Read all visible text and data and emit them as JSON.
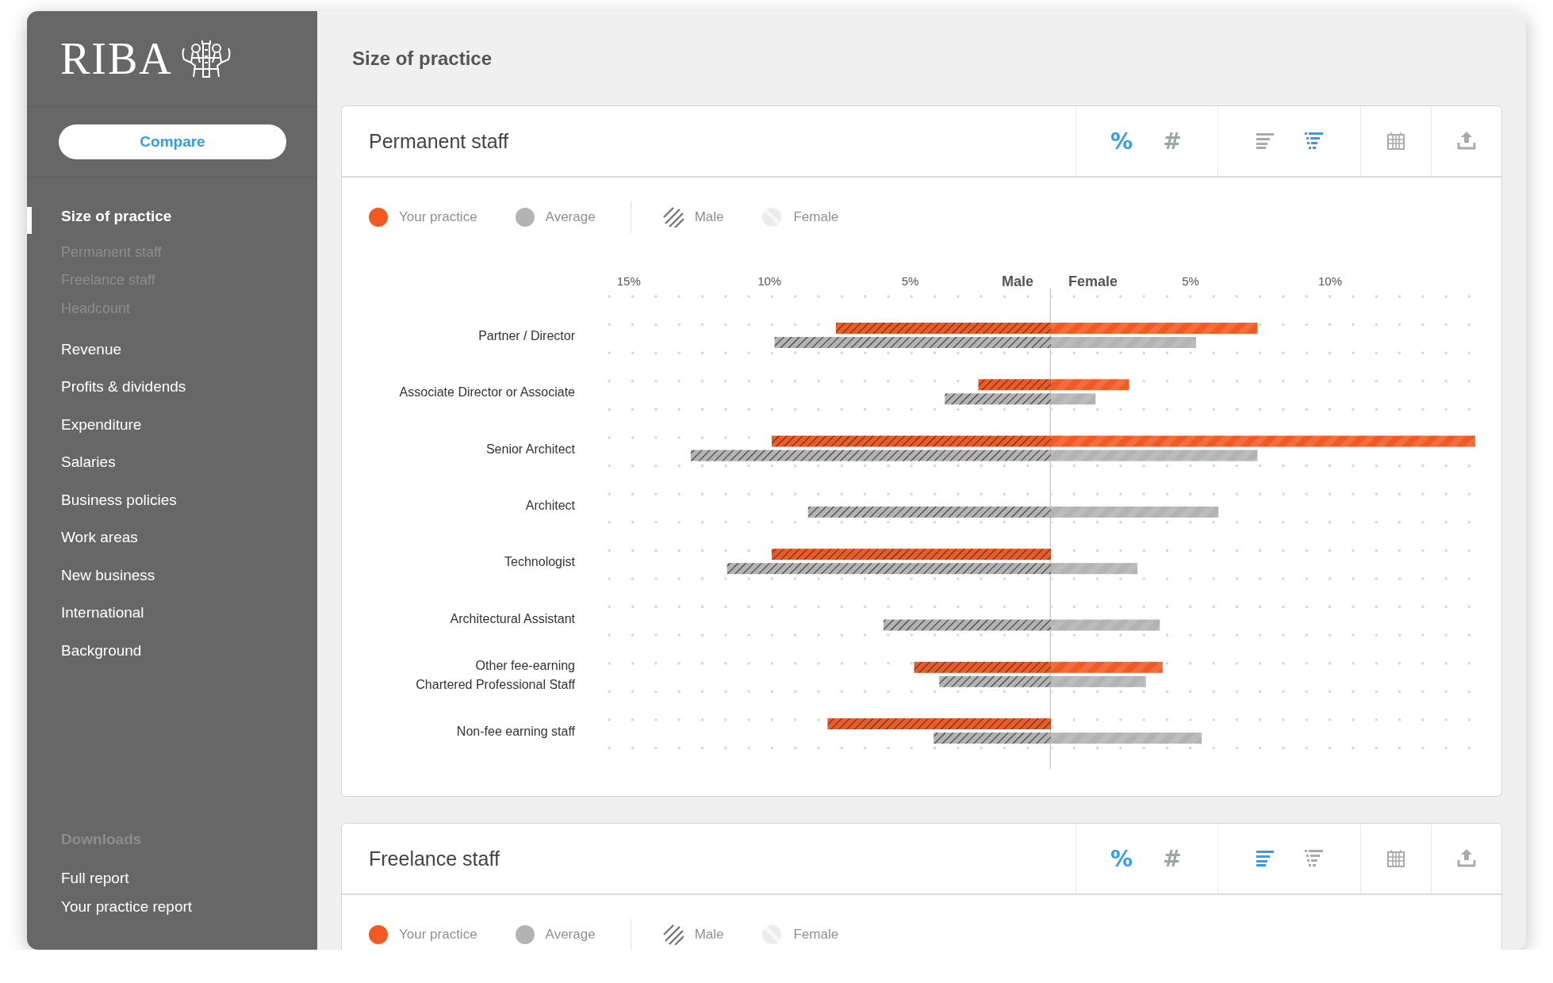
{
  "sidebar": {
    "logo": "RIBA",
    "compare_button": "Compare",
    "nav": [
      {
        "label": "Size of practice",
        "selected": true,
        "children": [
          {
            "label": "Permanent staff",
            "selected": false
          },
          {
            "label": "Freelance staff",
            "selected": false
          },
          {
            "label": "Headcount",
            "selected": false
          }
        ]
      },
      {
        "label": "Revenue",
        "selected": false
      },
      {
        "label": "Profits & dividends",
        "selected": false
      },
      {
        "label": "Expenditure",
        "selected": false
      },
      {
        "label": "Salaries",
        "selected": false
      },
      {
        "label": "Business policies",
        "selected": false
      },
      {
        "label": "Work areas",
        "selected": false
      },
      {
        "label": "New business",
        "selected": false
      },
      {
        "label": "International",
        "selected": false
      },
      {
        "label": "Background",
        "selected": false
      }
    ],
    "downloads": {
      "heading": "Downloads",
      "links": [
        "Full report",
        "Your practice report"
      ]
    }
  },
  "page_title": "Size of practice",
  "panels": [
    {
      "title": "Permanent staff",
      "units": [
        {
          "label": "%",
          "selected": true
        },
        {
          "label": "#",
          "selected": false
        }
      ],
      "sort": [
        {
          "kind": "plain",
          "selected": false
        },
        {
          "kind": "grouped",
          "selected": true
        }
      ],
      "legend": [
        {
          "label": "Your practice",
          "kind": "dot",
          "color": "#f15a22"
        },
        {
          "label": "Average",
          "kind": "dot",
          "color": "#b3b3b3"
        },
        {
          "label": "Male",
          "kind": "hatch"
        },
        {
          "label": "Female",
          "kind": "shade"
        }
      ],
      "charts": [
        {
          "kind": "hatch",
          "chart_data": {
            "type": "bar",
            "orientation": "horizontal",
            "title": "Male",
            "categories": [
              "Partner / Director",
              "Associate Director or Associate",
              "Senior Architect",
              "Architect",
              "Technologist",
              "Architectural Assistant",
              "Other fee-earning\nChartered Professional Staff",
              "Non-fee earning staff"
            ],
            "series": [
              {
                "color": "#f15a22",
                "values": [
                  7.7,
                  2.6,
                  10.0,
                  null,
                  10.0,
                  null,
                  4.9,
                  8.0
                ]
              },
              {
                "color": "#b3b3b3",
                "values": [
                  9.9,
                  3.8,
                  12.9,
                  8.7,
                  11.6,
                  6.0,
                  4.0,
                  4.2
                ]
              }
            ],
            "xlim": [
              15,
              0
            ],
            "xticks": [
              {
                "value": 15,
                "label": "15%"
              },
              {
                "value": 10,
                "label": "10%"
              },
              {
                "value": 5,
                "label": "5%"
              }
            ]
          }
        },
        {
          "kind": "shade",
          "chart_data": {
            "type": "bar",
            "orientation": "horizontal",
            "title": "Female",
            "series": [
              {
                "color": "#f15a22",
                "values": [
                  7.4,
                  2.8,
                  15.2,
                  null,
                  null,
                  null,
                  4.0,
                  null
                ]
              },
              {
                "color": "#b3b3b3",
                "values": [
                  5.2,
                  1.6,
                  7.4,
                  6.0,
                  3.1,
                  3.9,
                  3.4,
                  5.4
                ]
              }
            ],
            "xlim": [
              0,
              15.2
            ],
            "xticks": [
              {
                "value": 5,
                "label": "5%"
              },
              {
                "value": 10,
                "label": "10%"
              }
            ]
          }
        }
      ]
    },
    {
      "title": "Freelance staff",
      "units": [
        {
          "label": "%",
          "selected": true
        },
        {
          "label": "#",
          "selected": false
        }
      ],
      "sort": [
        {
          "kind": "plain",
          "selected": true
        },
        {
          "kind": "grouped",
          "selected": false
        }
      ],
      "legend": [
        {
          "label": "Your practice",
          "kind": "dot",
          "color": "#f15a22"
        },
        {
          "label": "Average",
          "kind": "dot",
          "color": "#b3b3b3"
        },
        {
          "label": "Male",
          "kind": "hatch"
        },
        {
          "label": "Female",
          "kind": "shade"
        }
      ]
    }
  ]
}
